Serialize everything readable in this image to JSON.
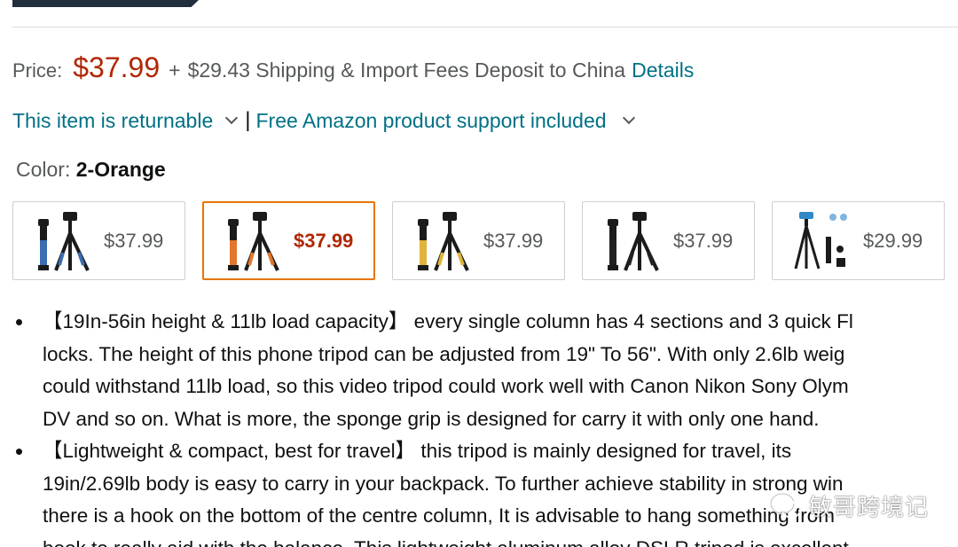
{
  "price": {
    "label": "Price:",
    "value": "$37.99",
    "plus": "+",
    "shipping": "$29.43 Shipping & Import Fees Deposit to China",
    "details_link": "Details"
  },
  "policies": {
    "returnable": "This item is returnable",
    "separator": "|",
    "support": "Free Amazon product support included"
  },
  "color": {
    "label": "Color:",
    "value": "2-Orange"
  },
  "swatches": [
    {
      "price": "$37.99",
      "accent": "#3a6fb0",
      "selected": false
    },
    {
      "price": "$37.99",
      "accent": "#e2772b",
      "selected": true
    },
    {
      "price": "$37.99",
      "accent": "#e0b43a",
      "selected": false
    },
    {
      "price": "$37.99",
      "accent": "#222222",
      "selected": false
    },
    {
      "price": "$29.99",
      "accent": "#2f89c7",
      "selected": false
    }
  ],
  "bullets": [
    {
      "lines": [
        "【19In-56in height & 11lb load capacity】 every single column has 4 sections and 3 quick Fl",
        "locks. The height of this phone tripod can be adjusted from 19\" To 56\". With only 2.6lb weig",
        "could withstand 11lb load, so this video tripod could work well with Canon Nikon Sony Olym",
        "DV and so on. What is more, the sponge grip is designed for carry it with only one hand."
      ]
    },
    {
      "lines": [
        "【Lightweight & compact, best for travel】 this tripod is mainly designed for travel, its",
        "19in/2.69lb body is easy to carry in your backpack. To further achieve stability in strong win",
        "there is a hook on the bottom of the centre column, It is advisable to hang something from",
        "hook to really aid with the balance. This lightweight aluminum alloy DSLR tripod is excellent"
      ]
    }
  ],
  "watermark": {
    "text": "敏哥跨境记",
    "icon": "wechat-icon"
  },
  "colors": {
    "price_red": "#b12704",
    "link_teal": "#007185",
    "selected_border": "#e77600"
  }
}
